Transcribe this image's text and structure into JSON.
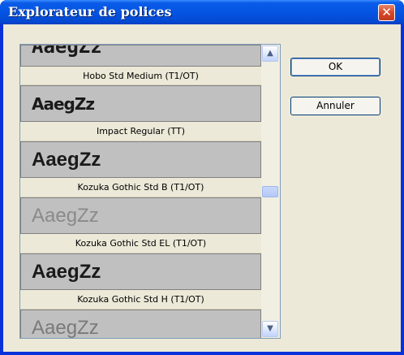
{
  "window": {
    "title": "Explorateur de polices",
    "close_glyph": "✕"
  },
  "font_list": {
    "items": [
      {
        "preview": "AaegZz",
        "name": "Hobo Std Medium (T1/OT)"
      },
      {
        "preview": "AaegZz",
        "name": "Impact Regular (TT)"
      },
      {
        "preview": "AaegZz",
        "name": "Kozuka Gothic Std B (T1/OT)"
      },
      {
        "preview": "AaegZz",
        "name": "Kozuka Gothic Std EL (T1/OT)"
      },
      {
        "preview": "AaegZz",
        "name": "Kozuka Gothic Std H (T1/OT)"
      },
      {
        "preview": "AaegZz",
        "name": ""
      }
    ]
  },
  "scrollbar": {
    "up_icon": "chevron-up-icon",
    "down_icon": "chevron-down-icon",
    "position": 0.5
  },
  "buttons": {
    "ok_label": "OK",
    "cancel_label": "Annuler"
  },
  "colors": {
    "titlebar": "#0554e3",
    "close_button": "#d8472a",
    "dialog_face": "#ece9d8",
    "preview_background": "#c0c0c0"
  }
}
